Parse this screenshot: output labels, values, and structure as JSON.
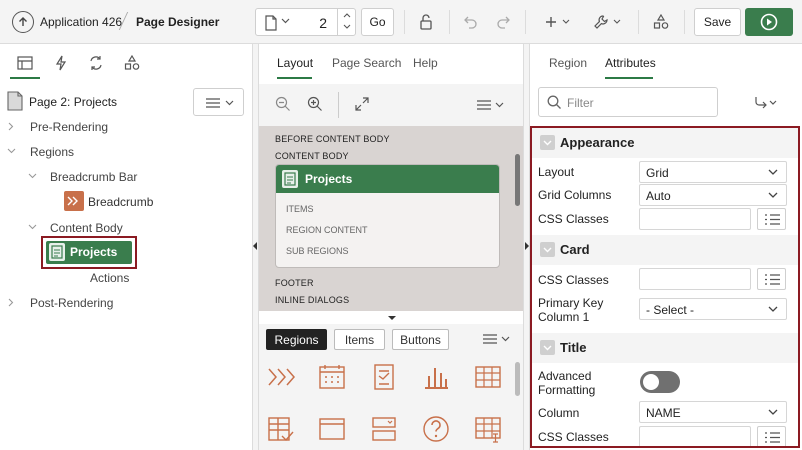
{
  "header": {
    "app_title": "Application 426",
    "page_designer": "Page Designer",
    "page_number": "2",
    "go_label": "Go",
    "save_label": "Save"
  },
  "left_panel": {
    "page_label": "Page 2: Projects",
    "tree": {
      "pre_rendering": "Pre-Rendering",
      "regions": "Regions",
      "breadcrumb_bar": "Breadcrumb Bar",
      "breadcrumb": "Breadcrumb",
      "content_body": "Content Body",
      "projects": "Projects",
      "actions": "Actions",
      "post_rendering": "Post-Rendering"
    }
  },
  "center_panel": {
    "tabs": [
      "Layout",
      "Page Search",
      "Help"
    ],
    "grid": {
      "before_content_body": "BEFORE CONTENT BODY",
      "content_body": "CONTENT BODY",
      "region_title": "Projects",
      "items": "ITEMS",
      "region_content": "REGION CONTENT",
      "sub_regions": "SUB REGIONS",
      "footer": "FOOTER",
      "inline_dialogs": "INLINE DIALOGS"
    },
    "palette_tabs": [
      "Regions",
      "Items",
      "Buttons"
    ]
  },
  "right_panel": {
    "tabs": [
      "Region",
      "Attributes"
    ],
    "filter_placeholder": "Filter",
    "appearance": {
      "title": "Appearance",
      "layout_label": "Layout",
      "layout_value": "Grid",
      "grid_columns_label": "Grid Columns",
      "grid_columns_value": "Auto",
      "css_classes_label": "CSS Classes"
    },
    "card": {
      "title": "Card",
      "css_classes_label": "CSS Classes",
      "primary_key_label_1": "Primary Key",
      "primary_key_label_2": "Column 1",
      "primary_key_value": "- Select -"
    },
    "title_section": {
      "title": "Title",
      "advanced_label_1": "Advanced",
      "advanced_label_2": "Formatting",
      "column_label": "Column",
      "column_value": "NAME",
      "css_classes_label": "CSS Classes"
    }
  },
  "colors": {
    "accent_green": "#3a7d4d",
    "highlight_red": "#8b1a22",
    "breadcrumb_orange": "#c8704a"
  }
}
